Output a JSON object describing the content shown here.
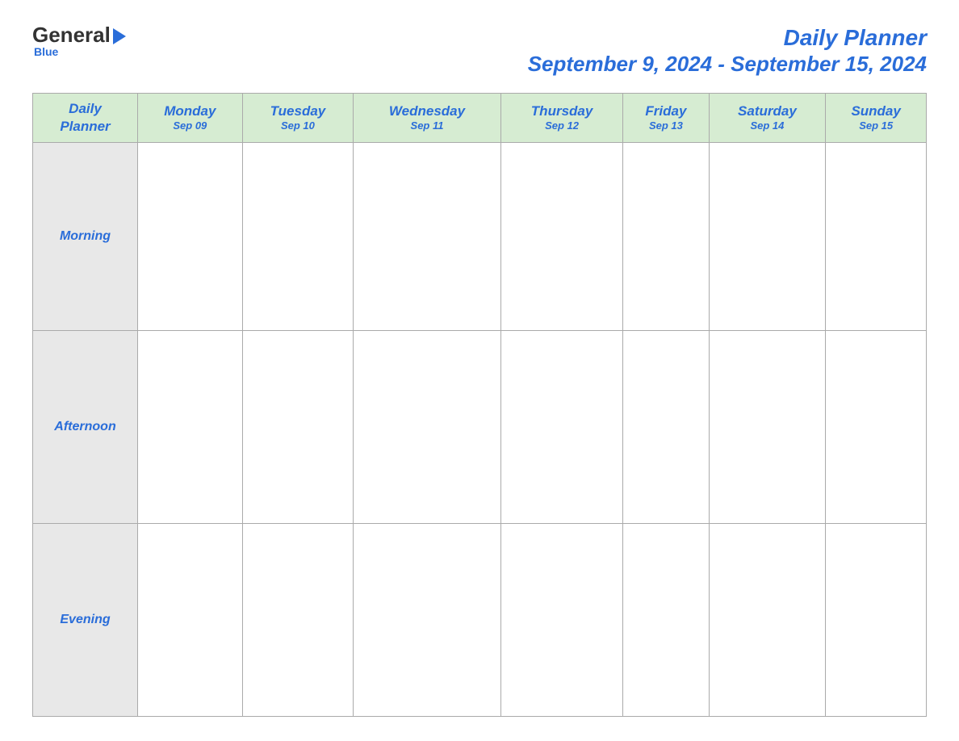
{
  "header": {
    "logo_general": "General",
    "logo_blue": "Blue",
    "title_main": "Daily Planner",
    "title_sub": "September 9, 2024 - September 15, 2024"
  },
  "table": {
    "label_header": "Daily\nPlanner",
    "time_slots": [
      "Morning",
      "Afternoon",
      "Evening"
    ],
    "days": [
      {
        "name": "Monday",
        "date": "Sep 09"
      },
      {
        "name": "Tuesday",
        "date": "Sep 10"
      },
      {
        "name": "Wednesday",
        "date": "Sep 11"
      },
      {
        "name": "Thursday",
        "date": "Sep 12"
      },
      {
        "name": "Friday",
        "date": "Sep 13"
      },
      {
        "name": "Saturday",
        "date": "Sep 14"
      },
      {
        "name": "Sunday",
        "date": "Sep 15"
      }
    ]
  }
}
